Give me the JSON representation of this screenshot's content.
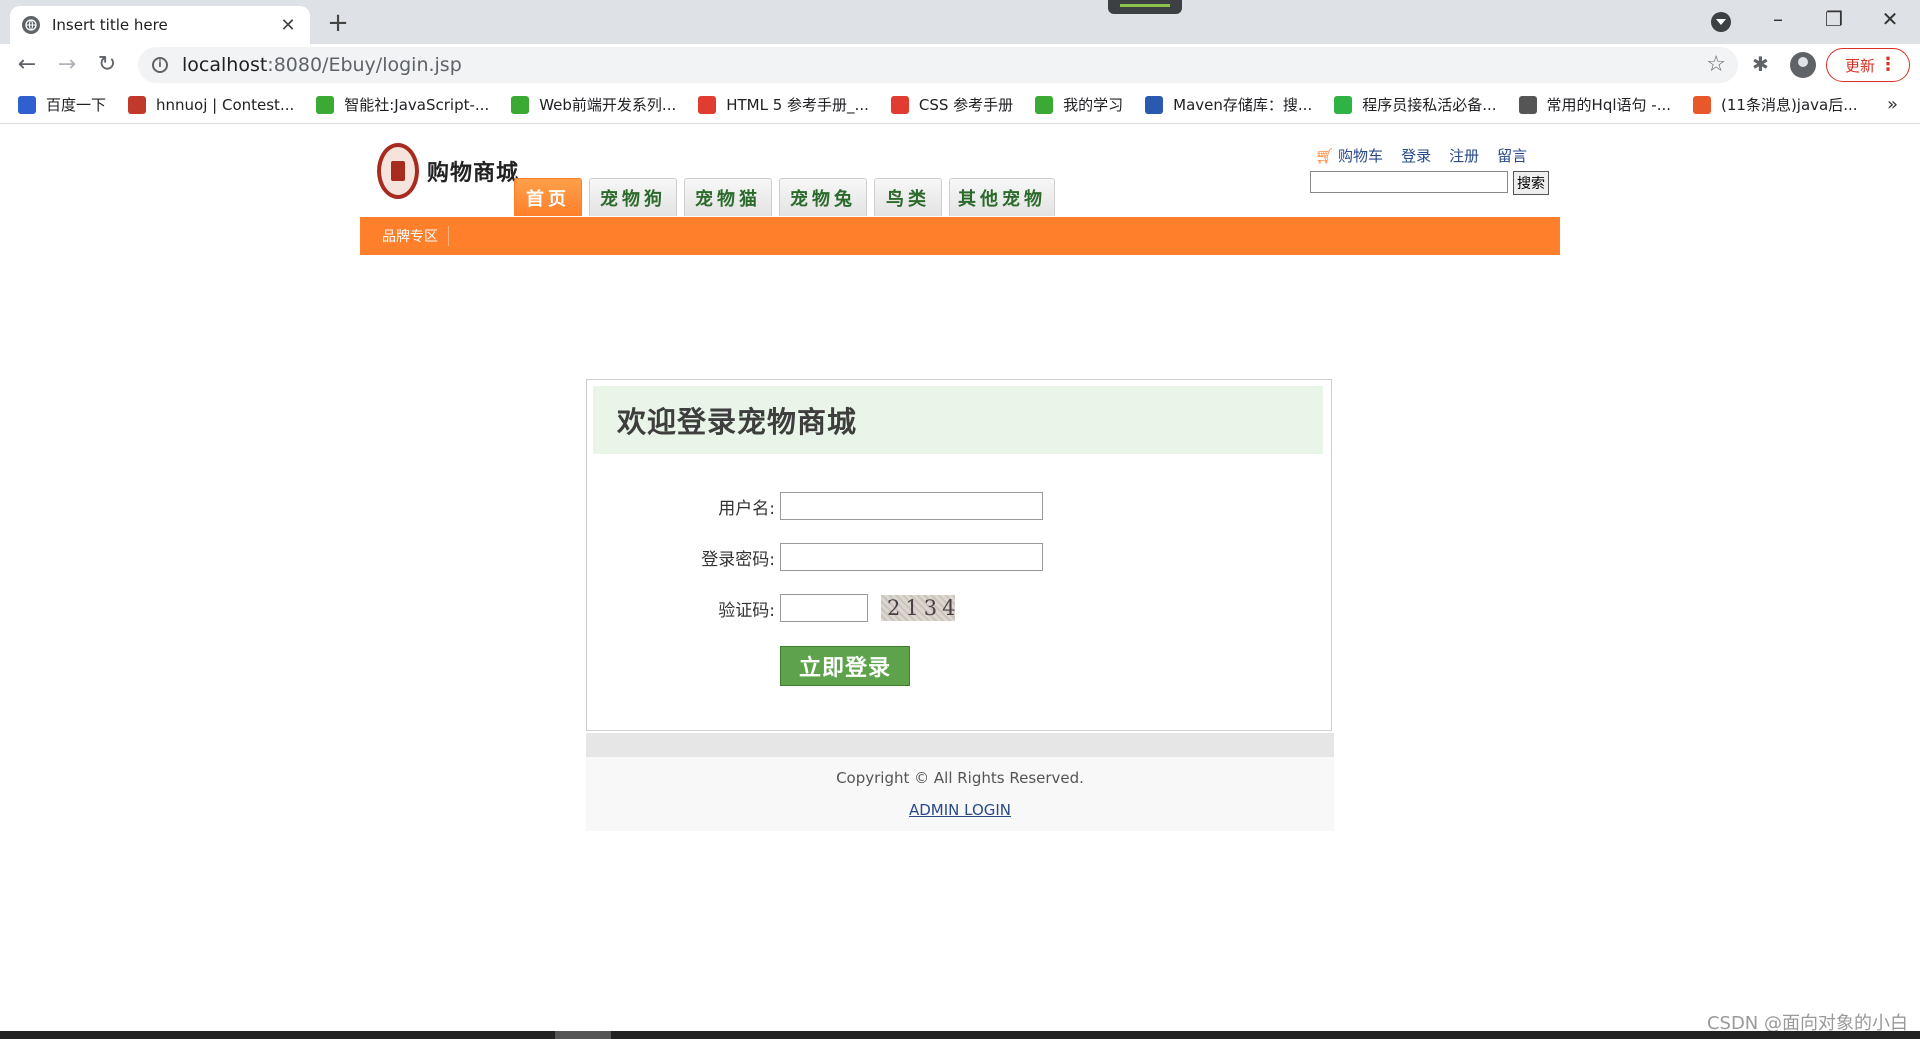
{
  "browser": {
    "tab_title": "Insert title here",
    "tab_close": "✕",
    "new_tab": "+",
    "url_host": "localhost",
    "url_rest": ":8080/Ebuy/login.jsp",
    "update_label": "更新",
    "bookmarks": [
      {
        "label": "百度一下",
        "color": "#3060d0"
      },
      {
        "label": "hnnuoj | Contest...",
        "color": "#c0392b"
      },
      {
        "label": "智能社:JavaScript-...",
        "color": "#3aaa35"
      },
      {
        "label": "Web前端开发系列...",
        "color": "#3aaa35"
      },
      {
        "label": "HTML 5 参考手册_...",
        "color": "#e03c31"
      },
      {
        "label": "CSS 参考手册",
        "color": "#e03c31"
      },
      {
        "label": "我的学习",
        "color": "#3aaa35"
      },
      {
        "label": "Maven存储库：搜...",
        "color": "#2a5ab0"
      },
      {
        "label": "程序员接私活必备...",
        "color": "#2fb345"
      },
      {
        "label": "常用的Hql语句 -...",
        "color": "#555555"
      },
      {
        "label": "(11条消息)java后...",
        "color": "#e8582a"
      }
    ],
    "bookmarks_more": "»"
  },
  "header": {
    "logo_text": "购物商城",
    "nav_tabs": [
      {
        "label": "首页",
        "active": true,
        "width": 68
      },
      {
        "label": "宠物狗",
        "active": false,
        "width": 88
      },
      {
        "label": "宠物猫",
        "active": false,
        "width": 88
      },
      {
        "label": "宠物兔",
        "active": false,
        "width": 88
      },
      {
        "label": "鸟类",
        "active": false,
        "width": 68
      },
      {
        "label": "其他宠物",
        "active": false,
        "width": 106
      }
    ],
    "links": {
      "cart": "购物车",
      "login": "登录",
      "register": "注册",
      "message": "留言"
    },
    "search_button": "搜索",
    "subnav_item": "品牌专区"
  },
  "login": {
    "title": "欢迎登录宠物商城",
    "username_label": "用户名:",
    "password_label": "登录密码:",
    "captcha_label": "验证码:",
    "captcha_text": "2134",
    "submit_label": "立即登录"
  },
  "footer": {
    "copyright": "Copyright © All Rights Reserved.",
    "admin_link": "ADMIN LOGIN"
  },
  "watermark": "CSDN @面向对象的小白",
  "colors": {
    "accent": "#ff7f2a",
    "login_header_bg": "#e8f5e8",
    "submit": "#5ea34b",
    "link": "#2a4a8a"
  }
}
